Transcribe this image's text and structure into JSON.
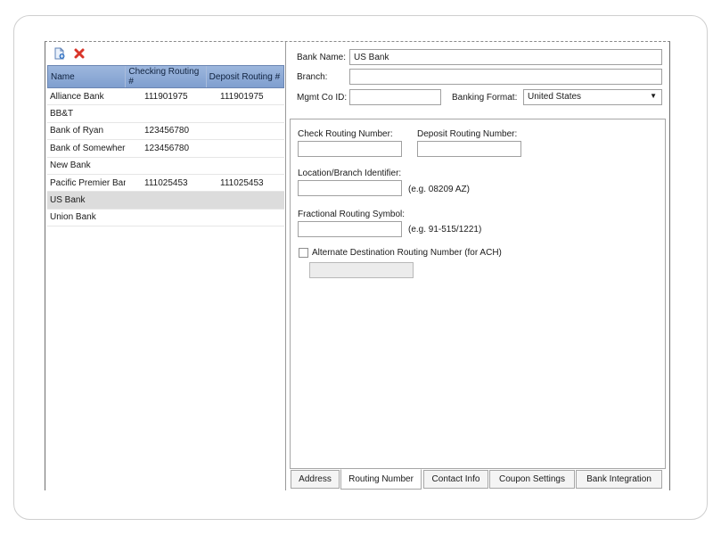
{
  "toolbar": {
    "add_icon": "add-document-icon",
    "delete_icon": "red-x-delete-icon"
  },
  "grid": {
    "columns": [
      "Name",
      "Checking Routing #",
      "Deposit Routing #"
    ],
    "rows": [
      {
        "name": "Alliance Bank",
        "checking": "111901975",
        "deposit": "111901975"
      },
      {
        "name": "BB&T",
        "checking": "",
        "deposit": ""
      },
      {
        "name": "Bank of Ryan",
        "checking": "123456780",
        "deposit": ""
      },
      {
        "name": "Bank of Somewhere",
        "checking": "123456780",
        "deposit": ""
      },
      {
        "name": "New Bank",
        "checking": "",
        "deposit": ""
      },
      {
        "name": "Pacific Premier Bank",
        "checking": "111025453",
        "deposit": "111025453"
      },
      {
        "name": "US Bank",
        "checking": "",
        "deposit": "",
        "selected": true
      },
      {
        "name": "Union Bank",
        "checking": "",
        "deposit": ""
      }
    ]
  },
  "form": {
    "bank_name_label": "Bank Name:",
    "bank_name_value": "US Bank",
    "branch_label": "Branch:",
    "branch_value": "",
    "mgmt_co_label": "Mgmt Co ID:",
    "mgmt_co_value": "",
    "banking_format_label": "Banking Format:",
    "banking_format_value": "United States"
  },
  "routing": {
    "check_routing_label": "Check Routing Number:",
    "deposit_routing_label": "Deposit Routing Number:",
    "location_label": "Location/Branch Identifier:",
    "location_hint": "(e.g.  08209 AZ)",
    "fractional_label": "Fractional Routing Symbol:",
    "fractional_hint": "(e.g.  91-515/1221)",
    "alternate_label": "Alternate Destination Routing Number (for ACH)"
  },
  "tabs": [
    "Address",
    "Routing Number",
    "Contact Info",
    "Coupon Settings",
    "Bank Integration"
  ],
  "active_tab": "Routing Number",
  "colors": {
    "header_blue": "#8aa8d6",
    "selected_row": "#dcdcdc",
    "delete_red": "#d9352a"
  }
}
